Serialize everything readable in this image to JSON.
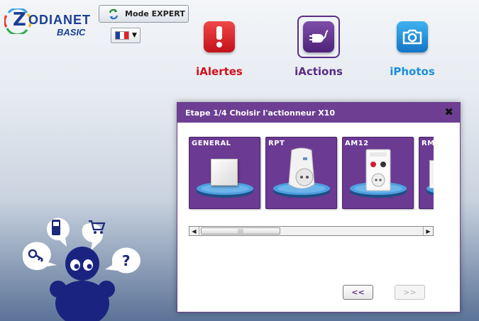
{
  "brand": {
    "logo_main": "ODIANET",
    "logo_letter": "Z",
    "logo_sub": "BASIC",
    "colors": {
      "logo": "#1a3e93"
    }
  },
  "header": {
    "mode_button": {
      "label": "Mode EXPERT",
      "icon": "refresh-arrows-icon"
    },
    "language": {
      "selected": "FR",
      "icon": "french-flag-icon"
    }
  },
  "nav": [
    {
      "label": "iAlertes",
      "icon": "exclamation-icon",
      "color": "#d0111c",
      "selected": false
    },
    {
      "label": "iActions",
      "icon": "plug-icon",
      "color": "#5a2d86",
      "selected": true
    },
    {
      "label": "iPhotos",
      "icon": "camera-icon",
      "color": "#1a8fd8",
      "selected": false
    }
  ],
  "dialog": {
    "title": "Etape 1/4 Choisir l'actionneur X10",
    "close_label": "✖",
    "cards": [
      {
        "title": "GENERAL",
        "icon": "generic-module-icon"
      },
      {
        "title": "RPT",
        "icon": "repeater-plug-icon"
      },
      {
        "title": "AM12",
        "icon": "appliance-module-icon"
      },
      {
        "title": "RMA",
        "icon": "module-icon"
      }
    ],
    "scrollbar": {
      "left_arrow": "◀",
      "right_arrow": "▶",
      "thumb_grip": "||||"
    },
    "prev_label": "<<",
    "next_label": ">>"
  },
  "mascot": {
    "bubbles": [
      "key-icon",
      "phone-icon",
      "cart-icon",
      "question-icon"
    ],
    "question_mark": "?"
  }
}
